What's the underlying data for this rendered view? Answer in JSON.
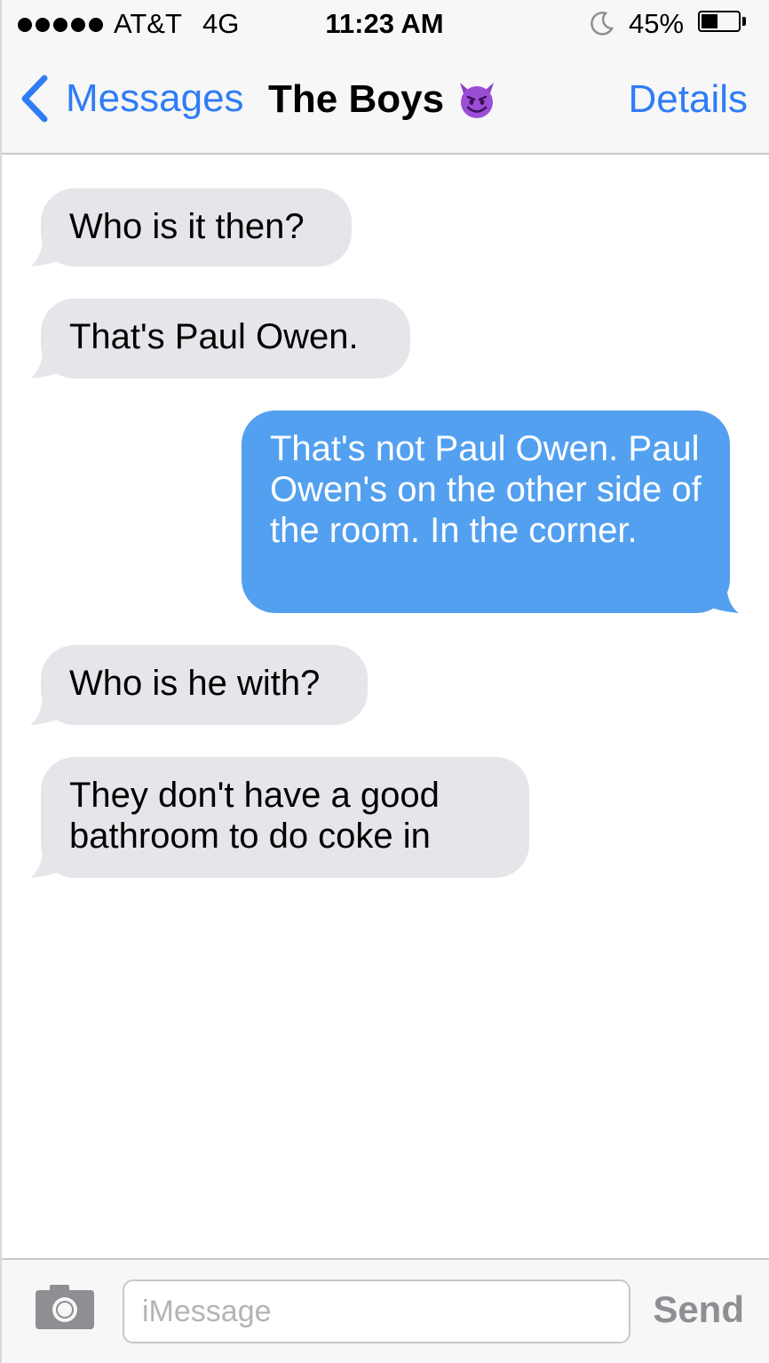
{
  "status_bar": {
    "signal_icon": "signal-dots-icon",
    "carrier": "AT&T",
    "network": "4G",
    "time": "11:23 AM",
    "do_not_disturb_icon": "moon-icon",
    "battery_percent": "45%",
    "battery_level": 0.45,
    "battery_icon": "battery-icon"
  },
  "nav_bar": {
    "back_label": "Messages",
    "back_icon": "chevron-left-icon",
    "title": "The Boys",
    "title_emoji": "smiling-devil-icon",
    "details_label": "Details",
    "accent_color": "#2f7cf6"
  },
  "messages": [
    {
      "direction": "incoming",
      "text": "Who is it then?"
    },
    {
      "direction": "incoming",
      "text": "That's Paul Owen."
    },
    {
      "direction": "outgoing",
      "text": "That's not Paul Owen. Paul Owen's on the other side of the room. In the corner."
    },
    {
      "direction": "incoming",
      "text": "Who is he with?"
    },
    {
      "direction": "incoming",
      "text": "They don't have a good bathroom to do coke in"
    }
  ],
  "colors": {
    "incoming_bubble": "#e5e5ea",
    "outgoing_bubble": "#53a0f0",
    "send_disabled": "#8e8e93"
  },
  "input_bar": {
    "camera_icon": "camera-icon",
    "placeholder": "iMessage",
    "value": "",
    "send_label": "Send"
  }
}
